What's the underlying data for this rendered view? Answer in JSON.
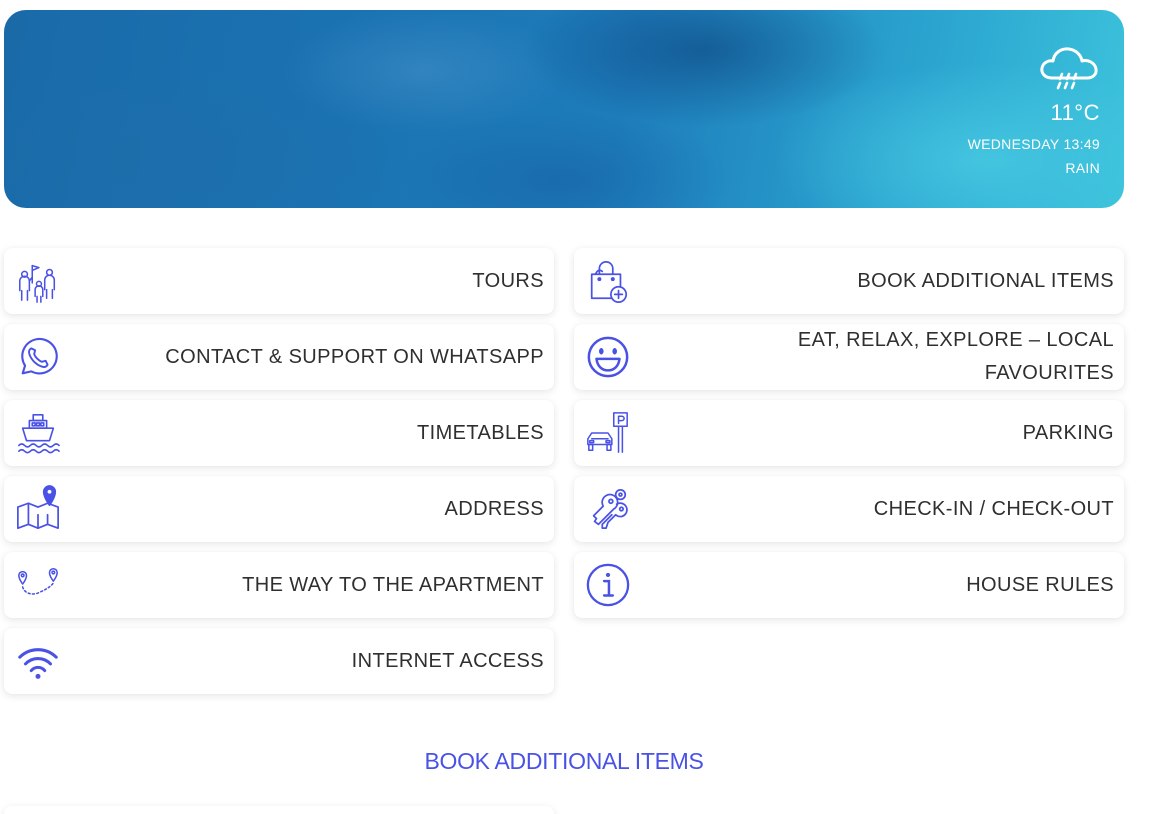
{
  "weather": {
    "icon": "rain-cloud-icon",
    "temperature": "11°C",
    "day_time": "WEDNESDAY 13:49",
    "condition": "RAIN"
  },
  "menu": {
    "left": [
      {
        "label": "TOURS",
        "icon": "tour-group-icon"
      },
      {
        "label": "CONTACT & SUPPORT ON WHATSAPP",
        "icon": "whatsapp-icon"
      },
      {
        "label": "TIMETABLES",
        "icon": "ferry-icon"
      },
      {
        "label": "ADDRESS",
        "icon": "map-pin-icon"
      },
      {
        "label": "THE WAY TO THE APARTMENT",
        "icon": "route-icon"
      },
      {
        "label": "INTERNET ACCESS",
        "icon": "wifi-icon"
      }
    ],
    "right": [
      {
        "label": "BOOK ADDITIONAL ITEMS",
        "icon": "shopping-bag-plus-icon"
      },
      {
        "label": "EAT, RELAX, EXPLORE – LOCAL FAVOURITES",
        "icon": "smiley-icon"
      },
      {
        "label": "PARKING",
        "icon": "parking-car-icon"
      },
      {
        "label": "CHECK-IN / CHECK-OUT",
        "icon": "keys-icon"
      },
      {
        "label": "HOUSE RULES",
        "icon": "info-icon"
      }
    ]
  },
  "section": {
    "title": "BOOK ADDITIONAL ITEMS"
  },
  "colors": {
    "accent": "#4a52e6",
    "text": "#2f2f2f"
  }
}
